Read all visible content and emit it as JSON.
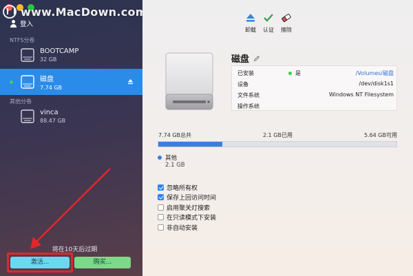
{
  "watermark": {
    "text": "www.MacDown.com"
  },
  "sidebar": {
    "login_label": "登入",
    "sections": [
      {
        "label": "NTFS分卷"
      },
      {
        "label": "其他分卷"
      }
    ],
    "volumes": [
      {
        "name": "BOOTCAMP",
        "size": "32 GB",
        "selected": false,
        "icon": "drive-icon"
      },
      {
        "name": "磁盘",
        "size": "7.74 GB",
        "selected": true,
        "icon": "drive-icon"
      },
      {
        "name": "vinca",
        "size": "88.47 GB",
        "selected": false,
        "icon": "drive-icon"
      }
    ],
    "expire_text": "将在10天后过期",
    "activate_label": "激活...",
    "buy_label": "购买..."
  },
  "toolbar": {
    "unmount_label": "卸载",
    "verify_label": "认证",
    "erase_label": "擦除"
  },
  "detail": {
    "title": "磁盘",
    "rows": [
      {
        "key": "已安装",
        "mid": "是",
        "value": "/Volumes/磁盘"
      },
      {
        "key": "设备",
        "value": "/dev/disk1s1"
      },
      {
        "key": "文件系统",
        "value": "Windows NT Filesystem"
      },
      {
        "key": "操作系统",
        "value": ""
      }
    ]
  },
  "usage": {
    "total": "7.74 GB总共",
    "used": "2.1 GB已用",
    "available": "5.64 GB可用",
    "used_fraction": 0.27,
    "legend_name": "其他",
    "legend_size": "2.1 GB"
  },
  "options": [
    {
      "label": "忽略所有权",
      "checked": true
    },
    {
      "label": "保存上回访问时间",
      "checked": true
    },
    {
      "label": "启用聚关灯搜索",
      "checked": false
    },
    {
      "label": "在只读模式下安装",
      "checked": false
    },
    {
      "label": "非自动安装",
      "checked": false
    }
  ],
  "colors": {
    "accent": "#2b8be8",
    "activate_button": "#6fd6f0",
    "buy_button": "#7dd88a",
    "annotation_red": "#e3262c"
  }
}
